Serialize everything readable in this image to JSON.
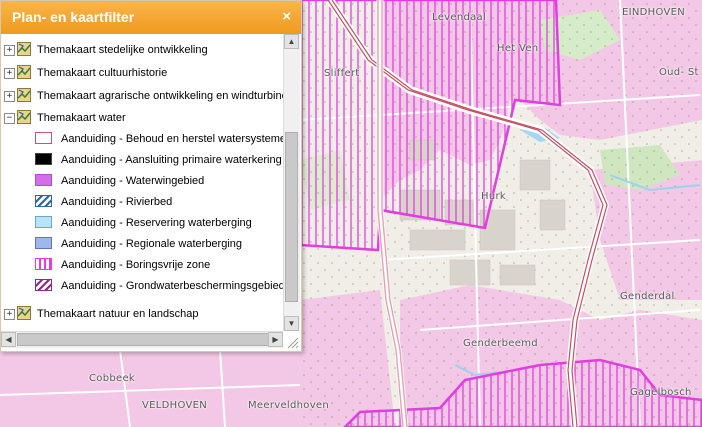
{
  "panel": {
    "title": "Plan- en kaartfilter",
    "close_icon": "×"
  },
  "themes": [
    {
      "label": "Themakaart stedelijke ontwikkeling",
      "toggle": "+"
    },
    {
      "label": "Themakaart cultuurhistorie",
      "toggle": "+"
    },
    {
      "label": "Themakaart agrarische ontwikkeling en windturbines",
      "toggle": "+"
    },
    {
      "label": "Themakaart water",
      "toggle": "−"
    },
    {
      "label": "Themakaart natuur en landschap",
      "toggle": "+"
    }
  ],
  "legend": [
    {
      "label": "Aanduiding - Behoud en herstel watersystemen",
      "swatch": "outline-pink"
    },
    {
      "label": "Aanduiding - Aansluiting primaire waterkering",
      "swatch": "solid-black"
    },
    {
      "label": "Aanduiding - Waterwingebied",
      "swatch": "solid-violet"
    },
    {
      "label": "Aanduiding - Rivierbed",
      "swatch": "hatch-blue"
    },
    {
      "label": "Aanduiding - Reservering waterberging",
      "swatch": "solid-lightblue"
    },
    {
      "label": "Aanduiding - Regionale waterberging",
      "swatch": "solid-blue"
    },
    {
      "label": "Aanduiding - Boringsvrije zone",
      "swatch": "vertical-magenta"
    },
    {
      "label": "Aanduiding - Grondwaterbeschermingsgebied",
      "swatch": "diagonal-purple"
    }
  ],
  "colors": {
    "header": "#f4a52e",
    "boringsvrije_zone": "#e040e0",
    "urban": "#f2c9e6",
    "road": "#d05a70"
  },
  "places": {
    "levendaal": "Levendaal",
    "eindhoven": "EINDHOVEN",
    "het_ven": "Het Ven",
    "oud_str": "Oud- St",
    "sliffert": "Sliffert",
    "hurk": "Hurk",
    "genderdal": "Genderdal",
    "genderbeemd": "Genderbeemd",
    "cobbeek": "Cobbeek",
    "veldhoven": "VELDHOVEN",
    "meerveldhoven": "Meerveldhoven",
    "gagelbosch": "Gagelbosch"
  }
}
